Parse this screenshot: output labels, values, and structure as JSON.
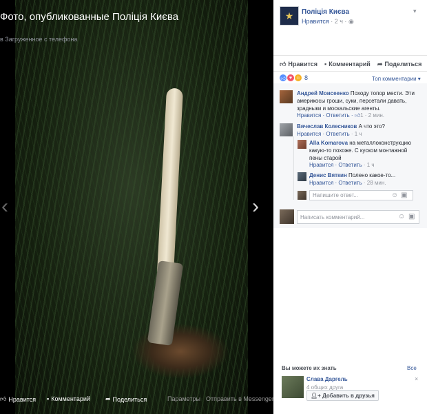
{
  "viewer": {
    "title": "Фото, опубликованные Поліція Києва",
    "subtitle": "в Загруженное с телефона",
    "bar": {
      "like": "Нравится",
      "comment": "Комментарий",
      "share": "Поделиться",
      "options": "Параметры",
      "messenger": "Отправить в Messenger"
    }
  },
  "post": {
    "page_name": "Поліція Києва",
    "like_link": "Нравится",
    "time": "· 2 ч ·",
    "actions": {
      "like": "Нравится",
      "comment": "Комментарий",
      "share": "Поделиться"
    },
    "reaction_count": "8",
    "top_comments": "Топ комментарии ▾"
  },
  "comments": [
    {
      "name": "Андрей Моисеенко",
      "text": "Походу топор мести. Эти америкосы гроши, суки, персетали давать, зрадныки и москальские агенты.",
      "like": "Нравится",
      "reply": "Ответить",
      "likes": "1",
      "time": "· 2 мин."
    },
    {
      "name": "Вячеслав Колесников",
      "text": "А что это?",
      "like": "Нравится",
      "reply": "Ответить",
      "time": "· 1 ч"
    }
  ],
  "replies": [
    {
      "name": "Alla Komarova",
      "text": "на металлоконструкцию какую-то похоже. С куском монтажной пены старой",
      "like": "Нравится",
      "reply": "Ответить",
      "time": "· 1 ч"
    },
    {
      "name": "Денис Вяткин",
      "text": "Полено какое-то...",
      "like": "Нравится",
      "reply": "Ответить",
      "time": "· 28 мин."
    }
  ],
  "reply_input_placeholder": "Напишите ответ...",
  "comment_input_placeholder": "Написать комментарий...",
  "suggestions": {
    "title": "Вы можете их знать",
    "all": "Все",
    "person": {
      "name": "Слава Даргель",
      "mutual": "4 общих друга",
      "add": "Добавить в друзья"
    }
  },
  "colors": {
    "link": "#365899",
    "muted": "#90949c",
    "like_blue": "#5890ff",
    "love_red": "#f25268",
    "haha_yellow": "#f7b125"
  }
}
